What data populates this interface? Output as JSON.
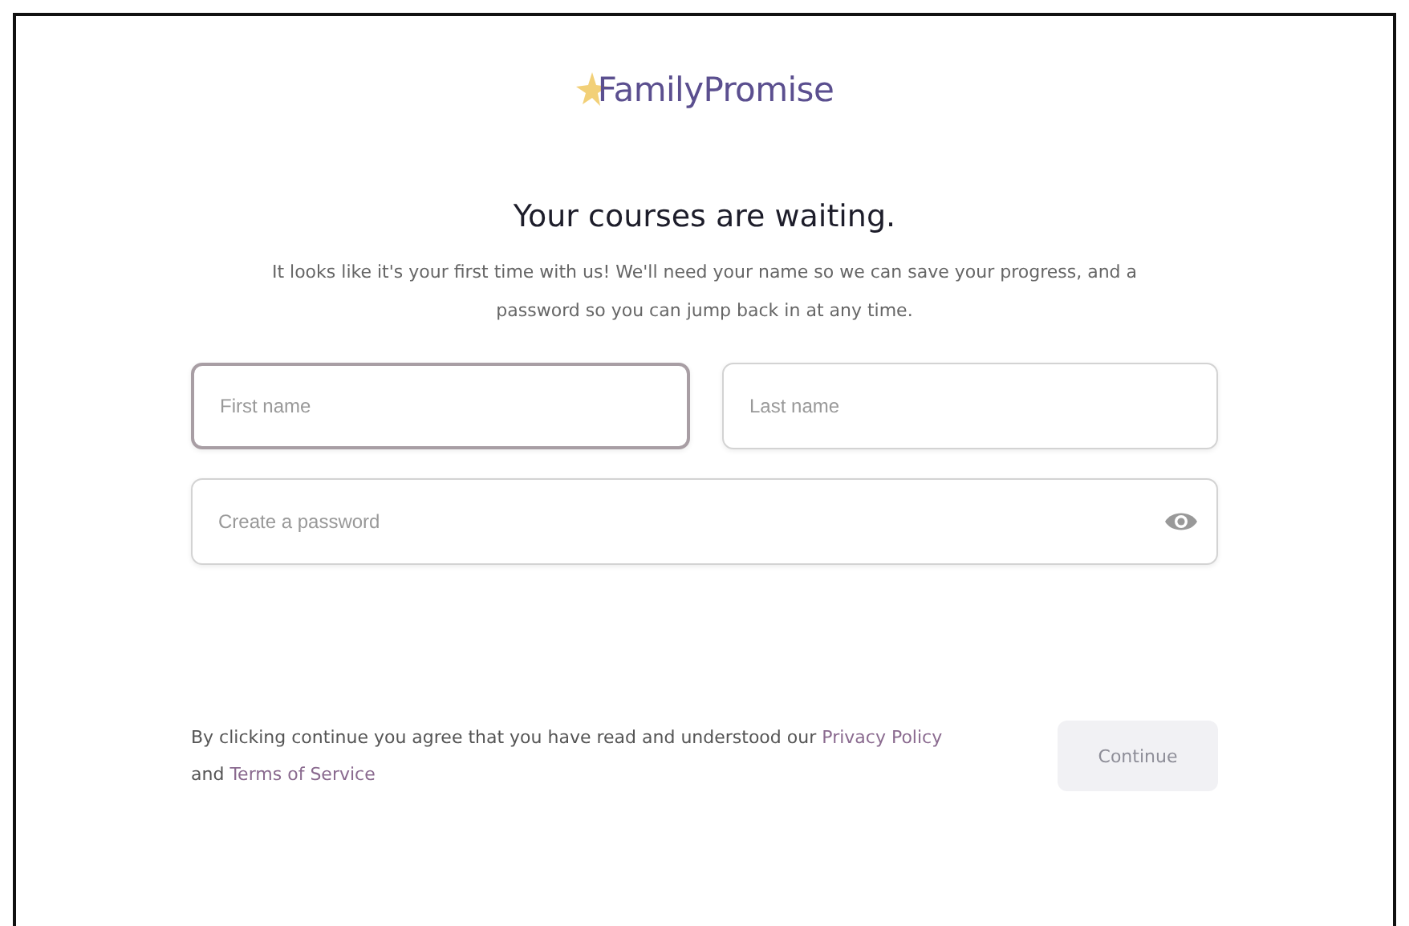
{
  "logo": {
    "text": "FamilyPromise"
  },
  "heading": "Your courses are waiting.",
  "intro": "It looks like it's your first time with us! We'll need your name so we can save your progress, and a password so you can jump back in at any time.",
  "fields": [
    {
      "placeholder": "First name",
      "focused": true
    },
    {
      "placeholder": "Last name",
      "focused": false
    }
  ],
  "password": {
    "placeholder": "Create a password",
    "focused": false
  },
  "consent": {
    "text": "By clicking continue you agree that you have read and understood our",
    "links": [
      "Privacy Policy",
      "Terms of Service"
    ],
    "joiner": "and"
  },
  "continue_button": {
    "label": "Continue",
    "disabled": true
  }
}
